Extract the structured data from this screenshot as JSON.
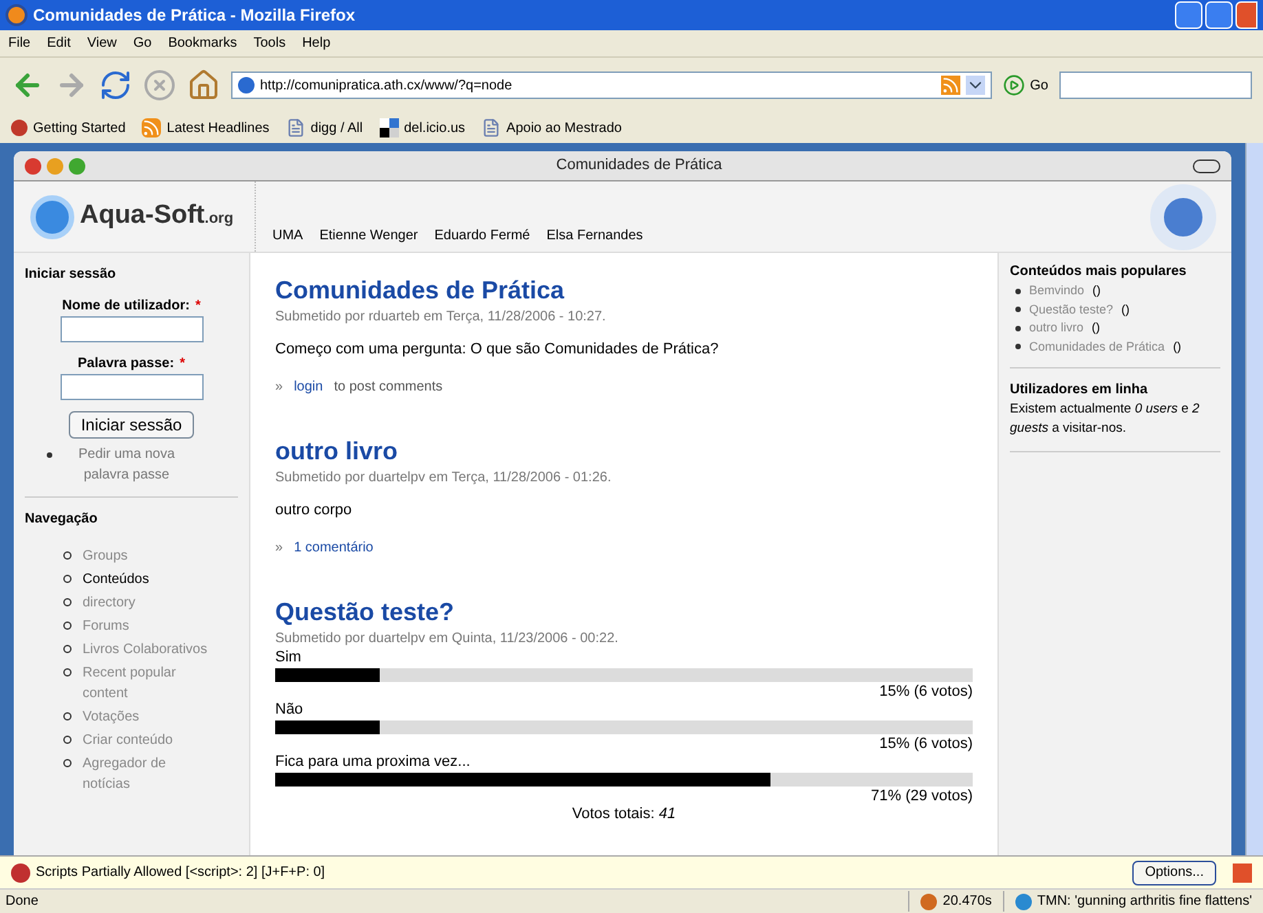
{
  "window": {
    "title": "Comunidades de Prática - Mozilla Firefox"
  },
  "menu": [
    "File",
    "Edit",
    "View",
    "Go",
    "Bookmarks",
    "Tools",
    "Help"
  ],
  "address": {
    "value": "http://comunipratica.ath.cx/www/?q=node"
  },
  "go_label": "Go",
  "bookmarks": [
    {
      "label": "Getting Started",
      "kind": "start"
    },
    {
      "label": "Latest Headlines",
      "kind": "feed"
    },
    {
      "label": "digg / All",
      "kind": "page"
    },
    {
      "label": "del.icio.us",
      "kind": "delicious"
    },
    {
      "label": "Apoio ao Mestrado",
      "kind": "page"
    }
  ],
  "site": {
    "window_title": "Comunidades de Prática",
    "logo_text": "Aqua-Soft",
    "logo_suffix": ".org",
    "top_links": [
      "UMA",
      "Etienne Wenger",
      "Eduardo Fermé",
      "Elsa Fernandes"
    ]
  },
  "login": {
    "heading": "Iniciar sessão",
    "fields": [
      {
        "label": "Nome de utilizador:",
        "required_mark": "*"
      },
      {
        "label": "Palavra passe:",
        "required_mark": "*"
      }
    ],
    "button": "Iniciar sessão",
    "link": "Pedir uma nova palavra passe"
  },
  "navigation": {
    "heading": "Navegação",
    "items": [
      {
        "label": "Groups",
        "selected": false
      },
      {
        "label": "Conteúdos",
        "selected": true
      },
      {
        "label": "directory",
        "selected": false
      },
      {
        "label": "Forums",
        "selected": false
      },
      {
        "label": "Livros Colaborativos",
        "selected": false
      },
      {
        "label": "Recent popular content",
        "selected": false
      },
      {
        "label": "Votações",
        "selected": false
      },
      {
        "label": "Criar conteúdo",
        "selected": false
      },
      {
        "label": "Agregador de notícias",
        "selected": false
      }
    ]
  },
  "posts": [
    {
      "kind": "story",
      "title": "Comunidades de Prática",
      "meta": "Submetido por rduarteb em Terça, 11/28/2006 - 10:27.",
      "body": "Começo com uma pergunta: O que são Comunidades de Prática?",
      "link": "login",
      "link_suffix": "to post comments",
      "arrow": "»"
    },
    {
      "kind": "story",
      "title": "outro livro",
      "meta": "Submetido por duartelpv em Terça, 11/28/2006 - 01:26.",
      "body": "outro corpo",
      "link": "1 comentário",
      "arrow": "»"
    },
    {
      "kind": "poll",
      "title": "Questão teste?",
      "meta": "Submetido por duartelpv em Quinta, 11/23/2006 - 00:22.",
      "choices": [
        {
          "label": "Sim",
          "level": 0.15,
          "result": "15% (6 votos)"
        },
        {
          "label": "Não",
          "level": 0.15,
          "result": "15% (6 votos)"
        },
        {
          "label": "Fica para uma proxima vez...",
          "level": 0.71,
          "result": "71% (29 votos)"
        }
      ],
      "total": "Votos totais: *41*"
    }
  ],
  "popular": {
    "heading": "Conteúdos mais populares",
    "items": [
      {
        "title": "Bemvindo",
        "count": "()"
      },
      {
        "title": "Questão teste?",
        "count": "()"
      },
      {
        "title": "outro livro",
        "count": "()"
      },
      {
        "title": "Comunidades de Prática",
        "count": "()"
      }
    ]
  },
  "online": {
    "heading": "Utilizadores em linha",
    "text": "Existem actualmente *0 users* e *2 guests* a visitar-nos."
  },
  "notification": {
    "text": "Scripts Partially Allowed [<script>: 2] [J+F+P: 0]",
    "button": "Options..."
  },
  "status_bar": {
    "text": "Done",
    "timer": "20.470s",
    "tmn": "TMN: 'gunning arthritis fine flattens'"
  }
}
